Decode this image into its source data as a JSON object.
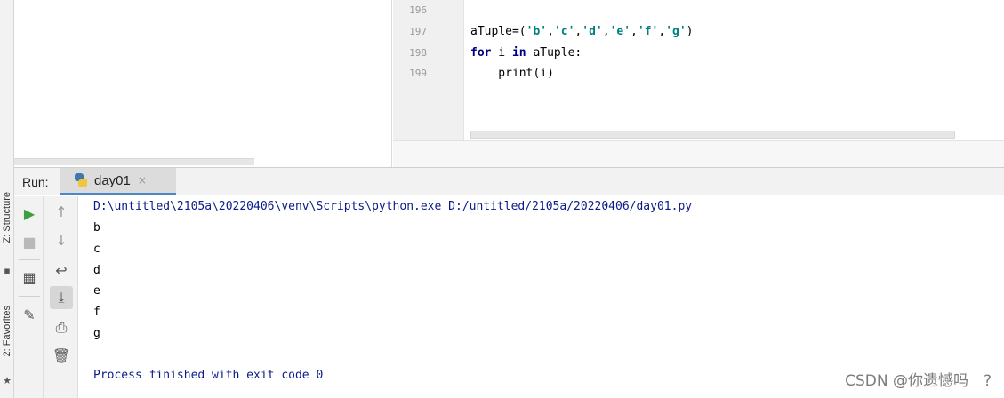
{
  "left_strip": {
    "structure_label": "Z: Structure",
    "favorites_label": "2: Favorites"
  },
  "editor": {
    "line_numbers": [
      "196",
      "197",
      "198",
      "199"
    ],
    "lines": [
      {
        "segments": []
      },
      {
        "segments": [
          {
            "t": "aTuple=(",
            "c": ""
          },
          {
            "t": "'b'",
            "c": "str"
          },
          {
            "t": ",",
            "c": ""
          },
          {
            "t": "'c'",
            "c": "str"
          },
          {
            "t": ",",
            "c": ""
          },
          {
            "t": "'d'",
            "c": "str"
          },
          {
            "t": ",",
            "c": ""
          },
          {
            "t": "'e'",
            "c": "str"
          },
          {
            "t": ",",
            "c": ""
          },
          {
            "t": "'f'",
            "c": "str"
          },
          {
            "t": ",",
            "c": ""
          },
          {
            "t": "'g'",
            "c": "str"
          },
          {
            "t": ")",
            "c": ""
          }
        ]
      },
      {
        "segments": [
          {
            "t": "for",
            "c": "kw"
          },
          {
            "t": " i ",
            "c": ""
          },
          {
            "t": "in",
            "c": "kw"
          },
          {
            "t": " aTuple:",
            "c": ""
          }
        ]
      },
      {
        "segments": [
          {
            "t": "    print(i)",
            "c": ""
          }
        ]
      }
    ]
  },
  "run": {
    "title": "Run:",
    "tab_label": "day01",
    "tab_close": "×",
    "toolbar_left": [
      {
        "name": "rerun-icon",
        "glyph": "▶",
        "color": "#3f9e3f"
      },
      {
        "name": "stop-icon",
        "glyph": "■",
        "color": "#b9b9b9"
      },
      {
        "name": "layout-icon",
        "glyph": "▦",
        "color": "#555555"
      },
      {
        "name": "pin-icon",
        "glyph": "✎",
        "color": "#555555"
      }
    ],
    "toolbar_right": [
      {
        "name": "up-arrow-icon",
        "glyph": "↑",
        "color": "#9a9a9a"
      },
      {
        "name": "down-arrow-icon",
        "glyph": "↓",
        "color": "#9a9a9a"
      },
      {
        "name": "soft-wrap-icon",
        "glyph": "↩",
        "color": "#555555"
      },
      {
        "name": "scroll-to-end-icon",
        "glyph": "⤓",
        "color": "#555555"
      },
      {
        "name": "print-icon",
        "glyph": "⎙",
        "color": "#555555"
      },
      {
        "name": "trash-icon",
        "glyph": "🗑",
        "color": "#555555"
      }
    ],
    "console": {
      "command": "D:\\untitled\\2105a\\20220406\\venv\\Scripts\\python.exe D:/untitled/2105a/20220406/day01.py",
      "output": [
        "b",
        "c",
        "d",
        "e",
        "f",
        "g"
      ],
      "finish": "Process finished with exit code 0"
    }
  },
  "watermark": "CSDN @你遗憾吗",
  "help_mark": "?"
}
